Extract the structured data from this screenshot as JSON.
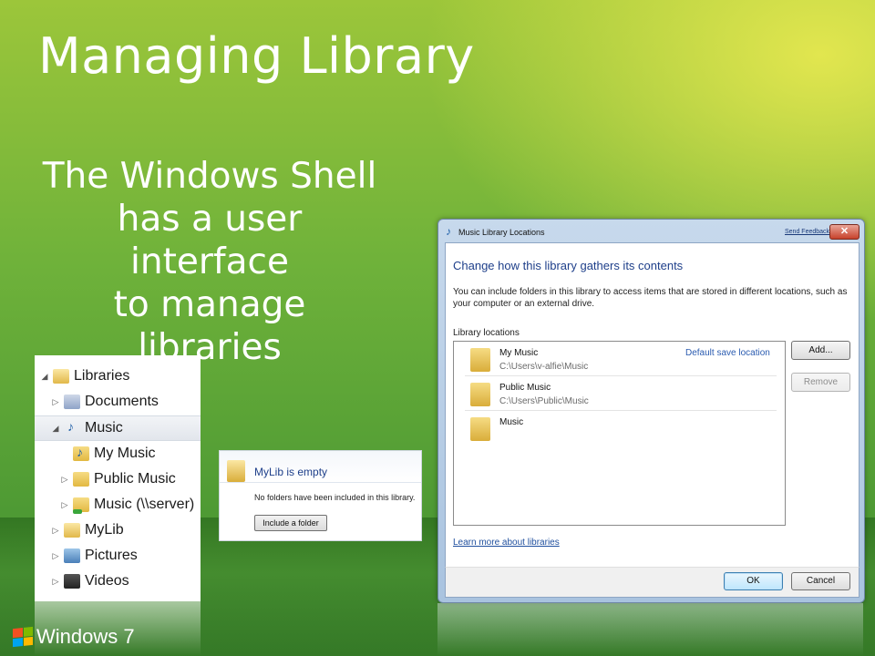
{
  "slide": {
    "title": "Managing Library",
    "body": [
      "The Windows Shell",
      "has a user interface",
      "to manage libraries"
    ],
    "brand": "Windows 7"
  },
  "tree": {
    "items": [
      {
        "label": "Libraries",
        "icon": "library-icon",
        "expander": "open"
      },
      {
        "label": "Documents",
        "icon": "documents-library-icon",
        "expander": "closed"
      },
      {
        "label": "Music",
        "icon": "music-library-icon",
        "expander": "open",
        "selected": true
      },
      {
        "label": "My Music",
        "icon": "music-folder-icon",
        "expander": "none"
      },
      {
        "label": "Public Music",
        "icon": "folder-icon",
        "expander": "closed"
      },
      {
        "label": "Music (\\\\server)",
        "icon": "network-music-folder-icon",
        "expander": "closed"
      },
      {
        "label": "MyLib",
        "icon": "library-icon",
        "expander": "closed"
      },
      {
        "label": "Pictures",
        "icon": "pictures-library-icon",
        "expander": "closed"
      },
      {
        "label": "Videos",
        "icon": "videos-library-icon",
        "expander": "closed"
      }
    ]
  },
  "empty_library": {
    "title": "MyLib is empty",
    "message": "No folders have been included in this library.",
    "button": "Include a folder"
  },
  "dialog": {
    "title": "Music Library Locations",
    "feedback": "Send Feedback",
    "close": "✕",
    "heading": "Change how this library gathers its contents",
    "description": "You can include folders in this library to access items that are stored in different locations, such as your computer or an external drive.",
    "section_label": "Library locations",
    "locations": [
      {
        "name": "My Music",
        "path": "C:\\Users\\v-alfie\\Music",
        "tag": "Default save location"
      },
      {
        "name": "Public Music",
        "path": "C:\\Users\\Public\\Music",
        "tag": ""
      },
      {
        "name": "Music",
        "path": "",
        "tag": ""
      }
    ],
    "add_button": "Add...",
    "remove_button": "Remove",
    "learn_link": "Learn more about libraries",
    "ok_button": "OK",
    "cancel_button": "Cancel"
  },
  "colors": {
    "link_blue": "#1f4f9e",
    "heading_blue": "#1e3f8a",
    "background_green": "#6fb23a",
    "background_yellow": "#e6e850"
  }
}
